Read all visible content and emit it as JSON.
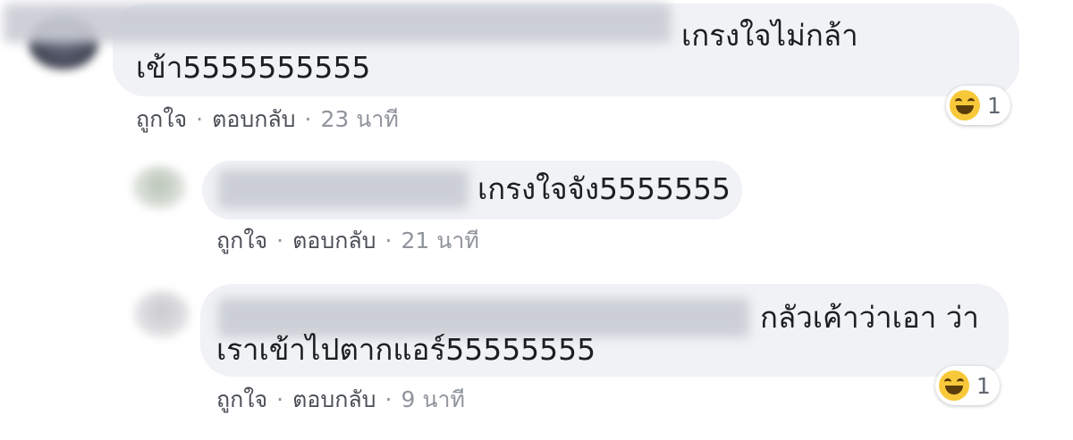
{
  "comments": [
    {
      "line1": "เกรงใจไม่กล้า",
      "line2": "เข้า5555555555",
      "actions": {
        "like": "ถูกใจ",
        "reply": "ตอบกลับ",
        "time": "23 นาที"
      },
      "reaction": {
        "icon": "haha-icon",
        "count": "1"
      }
    },
    {
      "line1": "เกรงใจจัง5555555",
      "actions": {
        "like": "ถูกใจ",
        "reply": "ตอบกลับ",
        "time": "21 นาที"
      }
    },
    {
      "line1": "กลัวเค้าว่าเอา ว่า",
      "line2": "เราเข้าไปตากแอร์55555555",
      "actions": {
        "like": "ถูกใจ",
        "reply": "ตอบกลับ",
        "time": "9 นาที"
      },
      "reaction": {
        "icon": "haha-icon",
        "count": "1"
      }
    }
  ],
  "separator": "·",
  "colors": {
    "bubble": "#f0f2f5",
    "haha": "#f7c93a",
    "meta": "#4b4f56"
  }
}
